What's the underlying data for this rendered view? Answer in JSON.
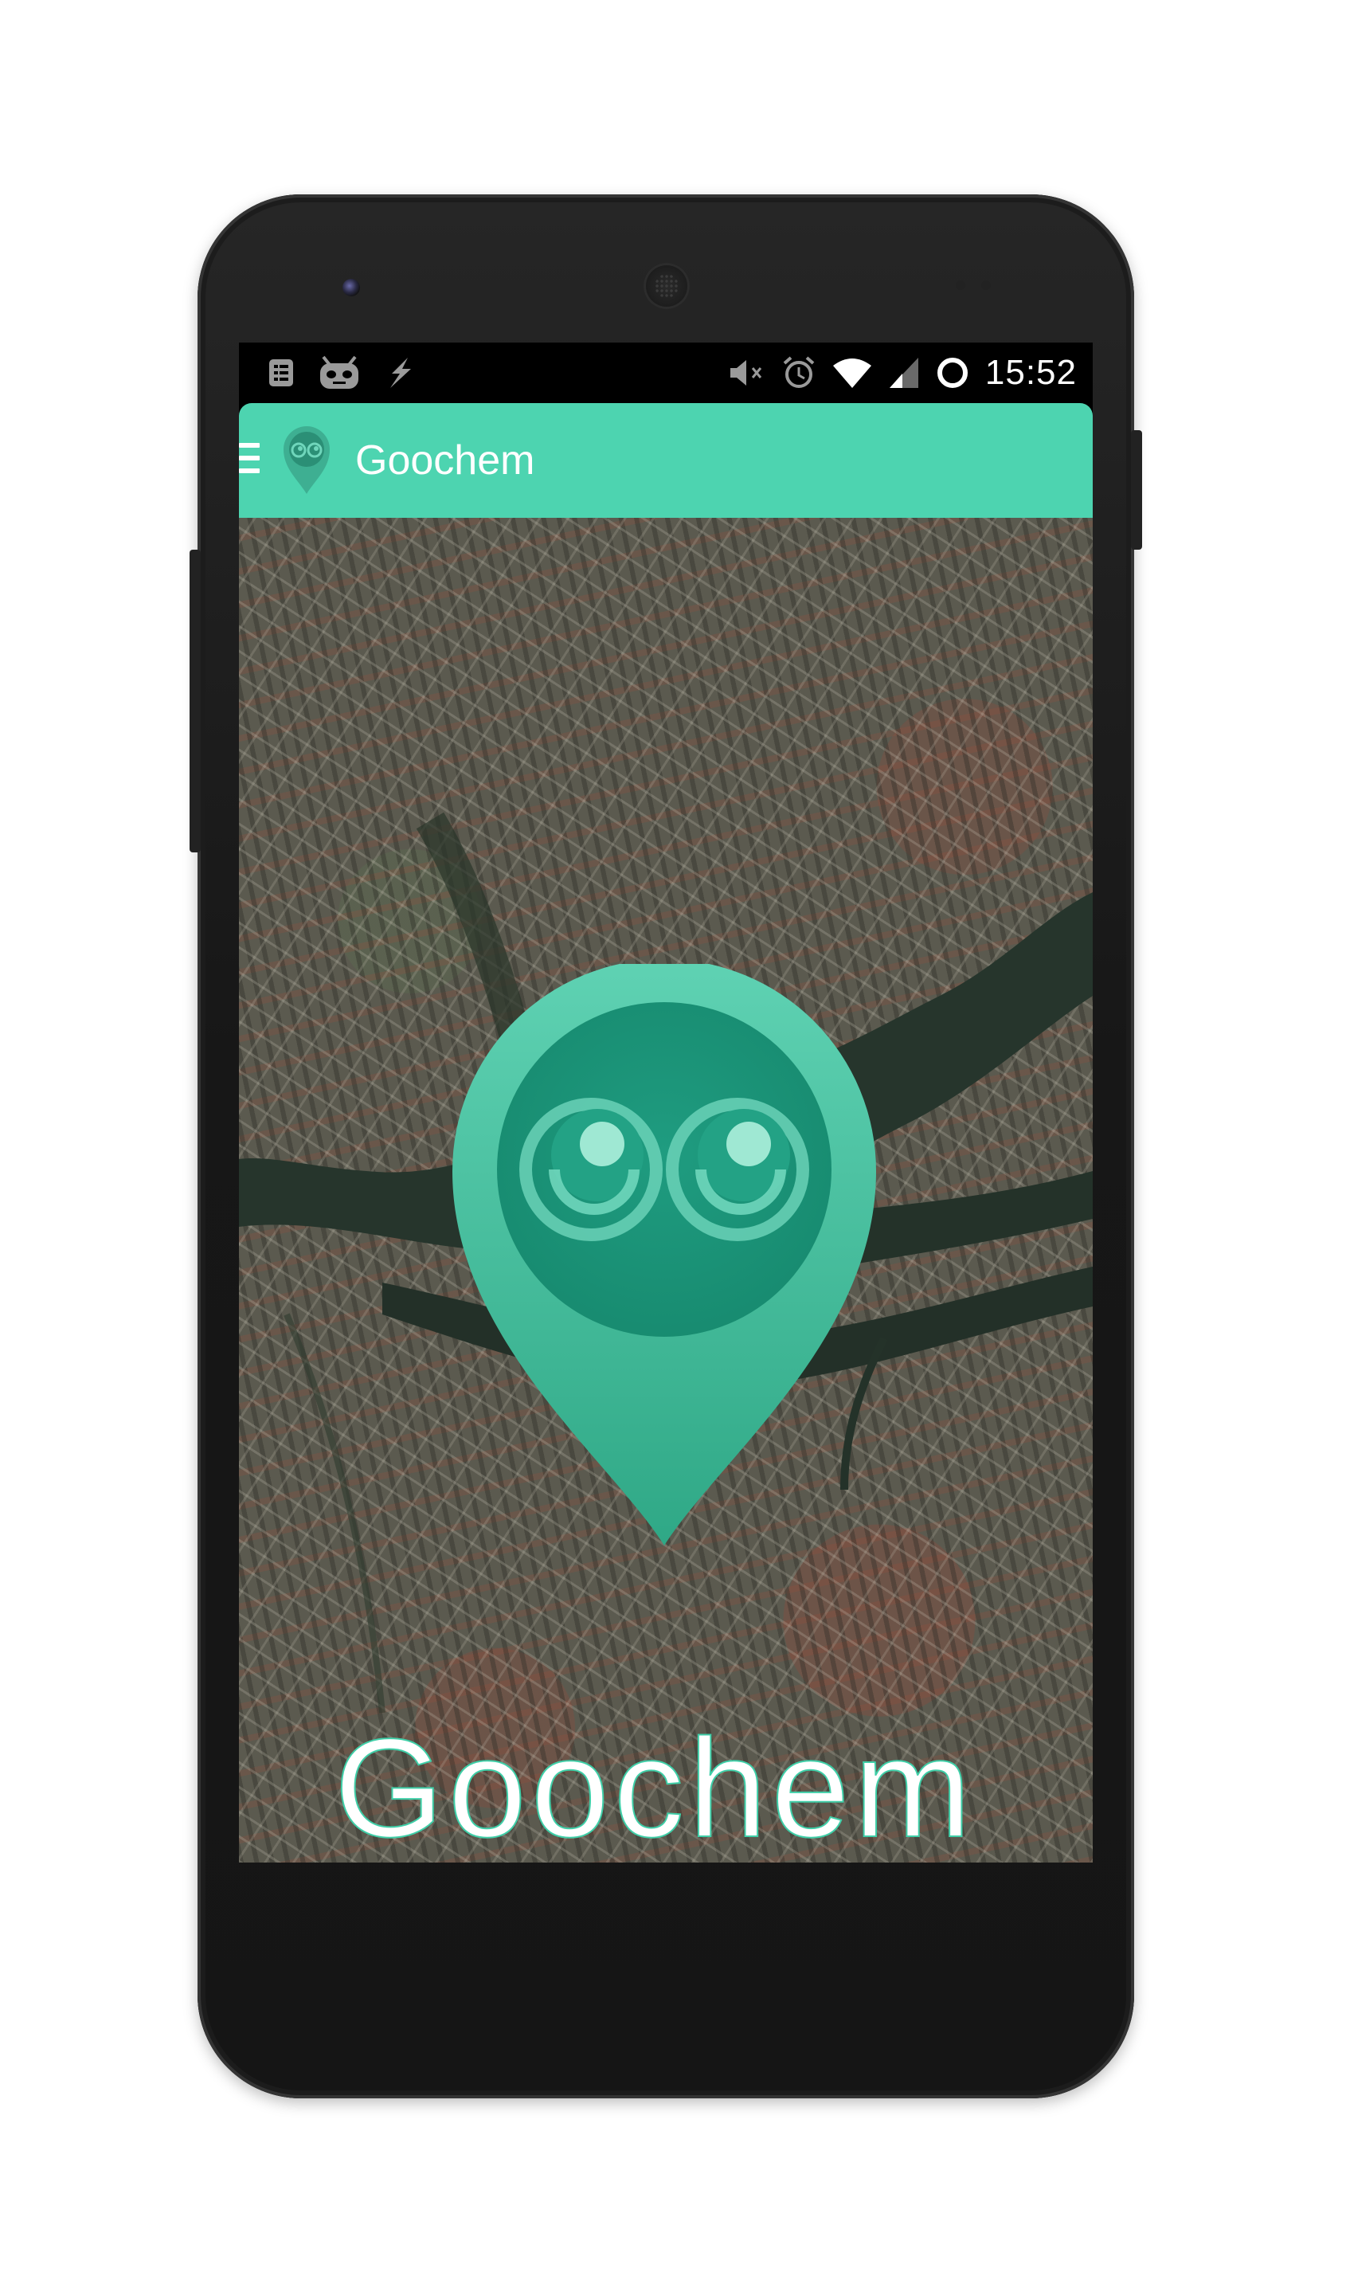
{
  "app": {
    "title": "Goochem",
    "wordmark": "Goochem",
    "accent_color": "#4dd4b0",
    "pin_color": "#1f9c80"
  },
  "status_bar": {
    "time": "15:52",
    "left_icons": [
      "notification-list-icon",
      "cyanogen-android-icon",
      "flash-icon"
    ],
    "right_icons": [
      "muted-volume-icon",
      "alarm-icon",
      "wifi-icon",
      "signal-icon",
      "circle-status-icon"
    ]
  },
  "app_bar": {
    "menu_icon": "hamburger-menu-icon",
    "logo_icon": "goochem-pin-logo-icon"
  },
  "content": {
    "background": "satellite-map-image",
    "center_icon": "goochem-location-pin-eyes-icon"
  }
}
